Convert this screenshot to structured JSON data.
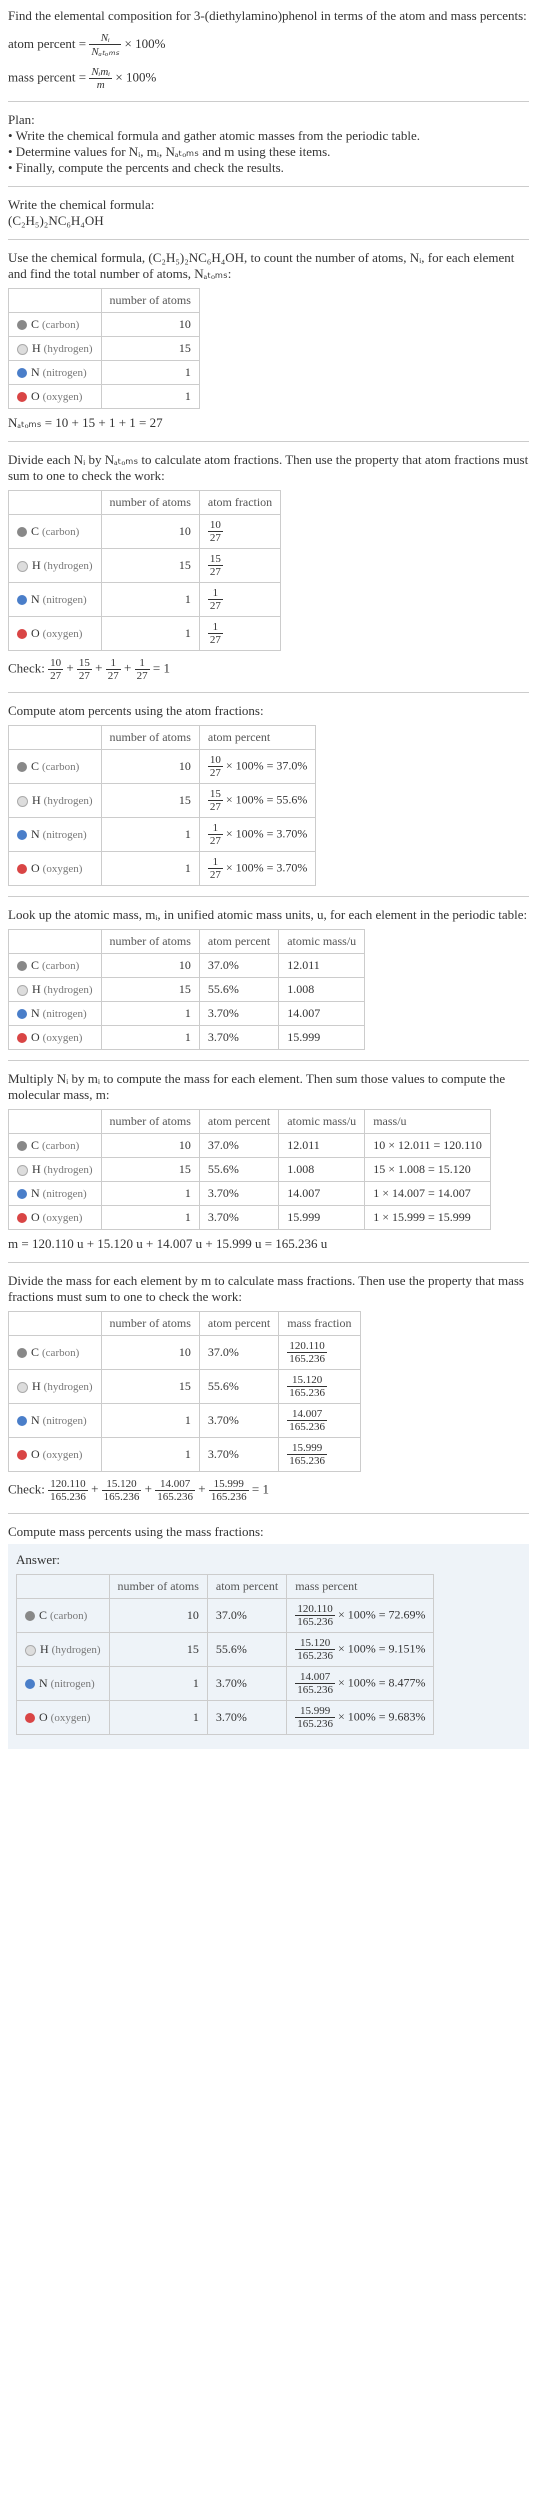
{
  "intro": {
    "line1": "Find the elemental composition for 3-(diethylamino)phenol in terms of the atom and mass percents:",
    "atom_percent_lhs": "atom percent =",
    "atom_percent_num": "Nᵢ",
    "atom_percent_den": "Nₐₜₒₘₛ",
    "times100": "× 100%",
    "mass_percent_lhs": "mass percent =",
    "mass_percent_num": "Nᵢmᵢ",
    "mass_percent_den": "m"
  },
  "plan": {
    "title": "Plan:",
    "b1": "• Write the chemical formula and gather atomic masses from the periodic table.",
    "b2": "• Determine values for Nᵢ, mᵢ, Nₐₜₒₘₛ and m using these items.",
    "b3": "• Finally, compute the percents and check the results."
  },
  "formula_section": {
    "prompt": "Write the chemical formula:",
    "formula": "(C₂H₅)₂NC₆H₄OH"
  },
  "count_section": {
    "text": "Use the chemical formula, (C₂H₅)₂NC₆H₄OH, to count the number of atoms, Nᵢ, for each element and find the total number of atoms, Nₐₜₒₘₛ:",
    "header_atoms": "number of atoms",
    "rows": [
      {
        "dot": "dot-c",
        "sym": "C",
        "name": "(carbon)",
        "n": "10"
      },
      {
        "dot": "dot-h",
        "sym": "H",
        "name": "(hydrogen)",
        "n": "15"
      },
      {
        "dot": "dot-n",
        "sym": "N",
        "name": "(nitrogen)",
        "n": "1"
      },
      {
        "dot": "dot-o",
        "sym": "O",
        "name": "(oxygen)",
        "n": "1"
      }
    ],
    "total": "Nₐₜₒₘₛ = 10 + 15 + 1 + 1 = 27"
  },
  "atomfrac_section": {
    "text": "Divide each Nᵢ by Nₐₜₒₘₛ to calculate atom fractions. Then use the property that atom fractions must sum to one to check the work:",
    "header_atoms": "number of atoms",
    "header_frac": "atom fraction",
    "rows": [
      {
        "dot": "dot-c",
        "sym": "C",
        "name": "(carbon)",
        "n": "10",
        "num": "10",
        "den": "27"
      },
      {
        "dot": "dot-h",
        "sym": "H",
        "name": "(hydrogen)",
        "n": "15",
        "num": "15",
        "den": "27"
      },
      {
        "dot": "dot-n",
        "sym": "N",
        "name": "(nitrogen)",
        "n": "1",
        "num": "1",
        "den": "27"
      },
      {
        "dot": "dot-o",
        "sym": "O",
        "name": "(oxygen)",
        "n": "1",
        "num": "1",
        "den": "27"
      }
    ],
    "check": "Check: ",
    "check_eq": " = 1"
  },
  "atompercent_section": {
    "text": "Compute atom percents using the atom fractions:",
    "header_atoms": "number of atoms",
    "header_pct": "atom percent",
    "rows": [
      {
        "dot": "dot-c",
        "sym": "C",
        "name": "(carbon)",
        "n": "10",
        "num": "10",
        "den": "27",
        "pct": "× 100% = 37.0%"
      },
      {
        "dot": "dot-h",
        "sym": "H",
        "name": "(hydrogen)",
        "n": "15",
        "num": "15",
        "den": "27",
        "pct": "× 100% = 55.6%"
      },
      {
        "dot": "dot-n",
        "sym": "N",
        "name": "(nitrogen)",
        "n": "1",
        "num": "1",
        "den": "27",
        "pct": "× 100% = 3.70%"
      },
      {
        "dot": "dot-o",
        "sym": "O",
        "name": "(oxygen)",
        "n": "1",
        "num": "1",
        "den": "27",
        "pct": "× 100% = 3.70%"
      }
    ]
  },
  "mass_lookup": {
    "text": "Look up the atomic mass, mᵢ, in unified atomic mass units, u, for each element in the periodic table:",
    "header_atoms": "number of atoms",
    "header_pct": "atom percent",
    "header_mass": "atomic mass/u",
    "rows": [
      {
        "dot": "dot-c",
        "sym": "C",
        "name": "(carbon)",
        "n": "10",
        "pct": "37.0%",
        "mass": "12.011"
      },
      {
        "dot": "dot-h",
        "sym": "H",
        "name": "(hydrogen)",
        "n": "15",
        "pct": "55.6%",
        "mass": "1.008"
      },
      {
        "dot": "dot-n",
        "sym": "N",
        "name": "(nitrogen)",
        "n": "1",
        "pct": "3.70%",
        "mass": "14.007"
      },
      {
        "dot": "dot-o",
        "sym": "O",
        "name": "(oxygen)",
        "n": "1",
        "pct": "3.70%",
        "mass": "15.999"
      }
    ]
  },
  "mass_mult": {
    "text": "Multiply Nᵢ by mᵢ to compute the mass for each element. Then sum those values to compute the molecular mass, m:",
    "header_atoms": "number of atoms",
    "header_pct": "atom percent",
    "header_mass": "atomic mass/u",
    "header_massu": "mass/u",
    "rows": [
      {
        "dot": "dot-c",
        "sym": "C",
        "name": "(carbon)",
        "n": "10",
        "pct": "37.0%",
        "mass": "12.011",
        "mult": "10 × 12.011 = 120.110"
      },
      {
        "dot": "dot-h",
        "sym": "H",
        "name": "(hydrogen)",
        "n": "15",
        "pct": "55.6%",
        "mass": "1.008",
        "mult": "15 × 1.008 = 15.120"
      },
      {
        "dot": "dot-n",
        "sym": "N",
        "name": "(nitrogen)",
        "n": "1",
        "pct": "3.70%",
        "mass": "14.007",
        "mult": "1 × 14.007 = 14.007"
      },
      {
        "dot": "dot-o",
        "sym": "O",
        "name": "(oxygen)",
        "n": "1",
        "pct": "3.70%",
        "mass": "15.999",
        "mult": "1 × 15.999 = 15.999"
      }
    ],
    "total": "m = 120.110 u + 15.120 u + 14.007 u + 15.999 u = 165.236 u"
  },
  "massfrac_section": {
    "text": "Divide the mass for each element by m to calculate mass fractions. Then use the property that mass fractions must sum to one to check the work:",
    "header_atoms": "number of atoms",
    "header_pct": "atom percent",
    "header_frac": "mass fraction",
    "rows": [
      {
        "dot": "dot-c",
        "sym": "C",
        "name": "(carbon)",
        "n": "10",
        "pct": "37.0%",
        "num": "120.110",
        "den": "165.236"
      },
      {
        "dot": "dot-h",
        "sym": "H",
        "name": "(hydrogen)",
        "n": "15",
        "pct": "55.6%",
        "num": "15.120",
        "den": "165.236"
      },
      {
        "dot": "dot-n",
        "sym": "N",
        "name": "(nitrogen)",
        "n": "1",
        "pct": "3.70%",
        "num": "14.007",
        "den": "165.236"
      },
      {
        "dot": "dot-o",
        "sym": "O",
        "name": "(oxygen)",
        "n": "1",
        "pct": "3.70%",
        "num": "15.999",
        "den": "165.236"
      }
    ],
    "check": "Check: ",
    "check_nums": [
      "120.110",
      "15.120",
      "14.007",
      "15.999"
    ],
    "check_den": "165.236",
    "check_eq": " = 1"
  },
  "final": {
    "text": "Compute mass percents using the mass fractions:",
    "answer_label": "Answer:",
    "header_atoms": "number of atoms",
    "header_pct": "atom percent",
    "header_mpct": "mass percent",
    "rows": [
      {
        "dot": "dot-c",
        "sym": "C",
        "name": "(carbon)",
        "n": "10",
        "pct": "37.0%",
        "num": "120.110",
        "den": "165.236",
        "res": "× 100% = 72.69%"
      },
      {
        "dot": "dot-h",
        "sym": "H",
        "name": "(hydrogen)",
        "n": "15",
        "pct": "55.6%",
        "num": "15.120",
        "den": "165.236",
        "res": "× 100% = 9.151%"
      },
      {
        "dot": "dot-n",
        "sym": "N",
        "name": "(nitrogen)",
        "n": "1",
        "pct": "3.70%",
        "num": "14.007",
        "den": "165.236",
        "res": "× 100% = 8.477%"
      },
      {
        "dot": "dot-o",
        "sym": "O",
        "name": "(oxygen)",
        "n": "1",
        "pct": "3.70%",
        "num": "15.999",
        "den": "165.236",
        "res": "× 100% = 9.683%"
      }
    ]
  }
}
